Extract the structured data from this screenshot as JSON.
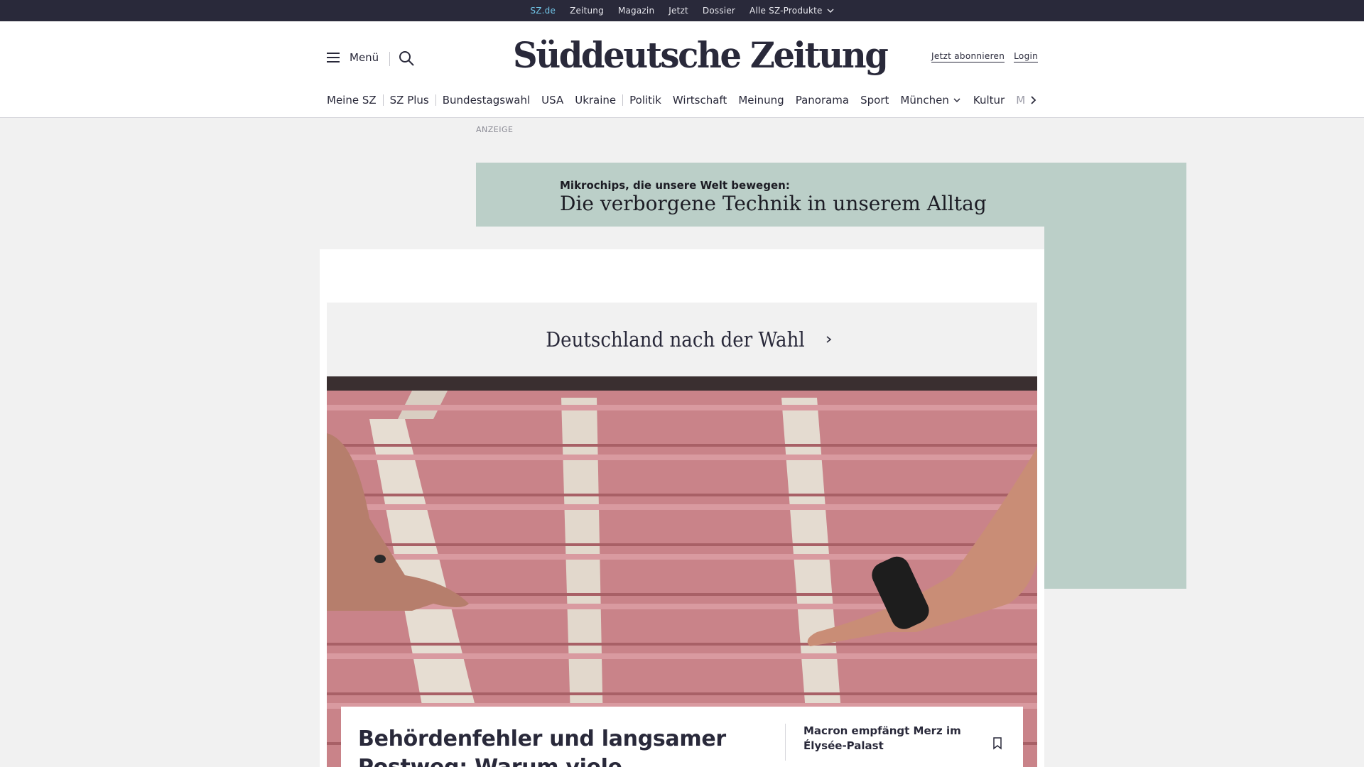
{
  "topbar": {
    "items": [
      "SZ.de",
      "Zeitung",
      "Magazin",
      "Jetzt",
      "Dossier",
      "Alle SZ-Produkte"
    ]
  },
  "header": {
    "menu_label": "Menü",
    "logo": "Süddeutsche Zeitung",
    "subscribe_label": "Jetzt abonnieren",
    "login_label": "Login"
  },
  "nav": {
    "items": [
      "Meine SZ",
      "SZ Plus",
      "Bundestagswahl",
      "USA",
      "Ukraine",
      "Politik",
      "Wirtschaft",
      "Meinung",
      "Panorama",
      "Sport",
      "München",
      "Kultur",
      "M"
    ]
  },
  "ad": {
    "label": "ANZEIGE",
    "kicker": "Mikrochips, die unsere Welt bewegen:",
    "title": "Die verborgene Technik in unserem Alltag"
  },
  "section": {
    "title": "Deutschland nach der Wahl"
  },
  "teaser": {
    "headline": "Behördenfehler und langsamer Postweg: Warum viele",
    "side_headline": "Macron empfängt Merz im Élysée-Palast"
  },
  "colors": {
    "topbar_bg": "#29293a",
    "active_link": "#71c5e8",
    "ad_bg": "#bbcfc8",
    "page_bg": "#f1f1f1"
  }
}
